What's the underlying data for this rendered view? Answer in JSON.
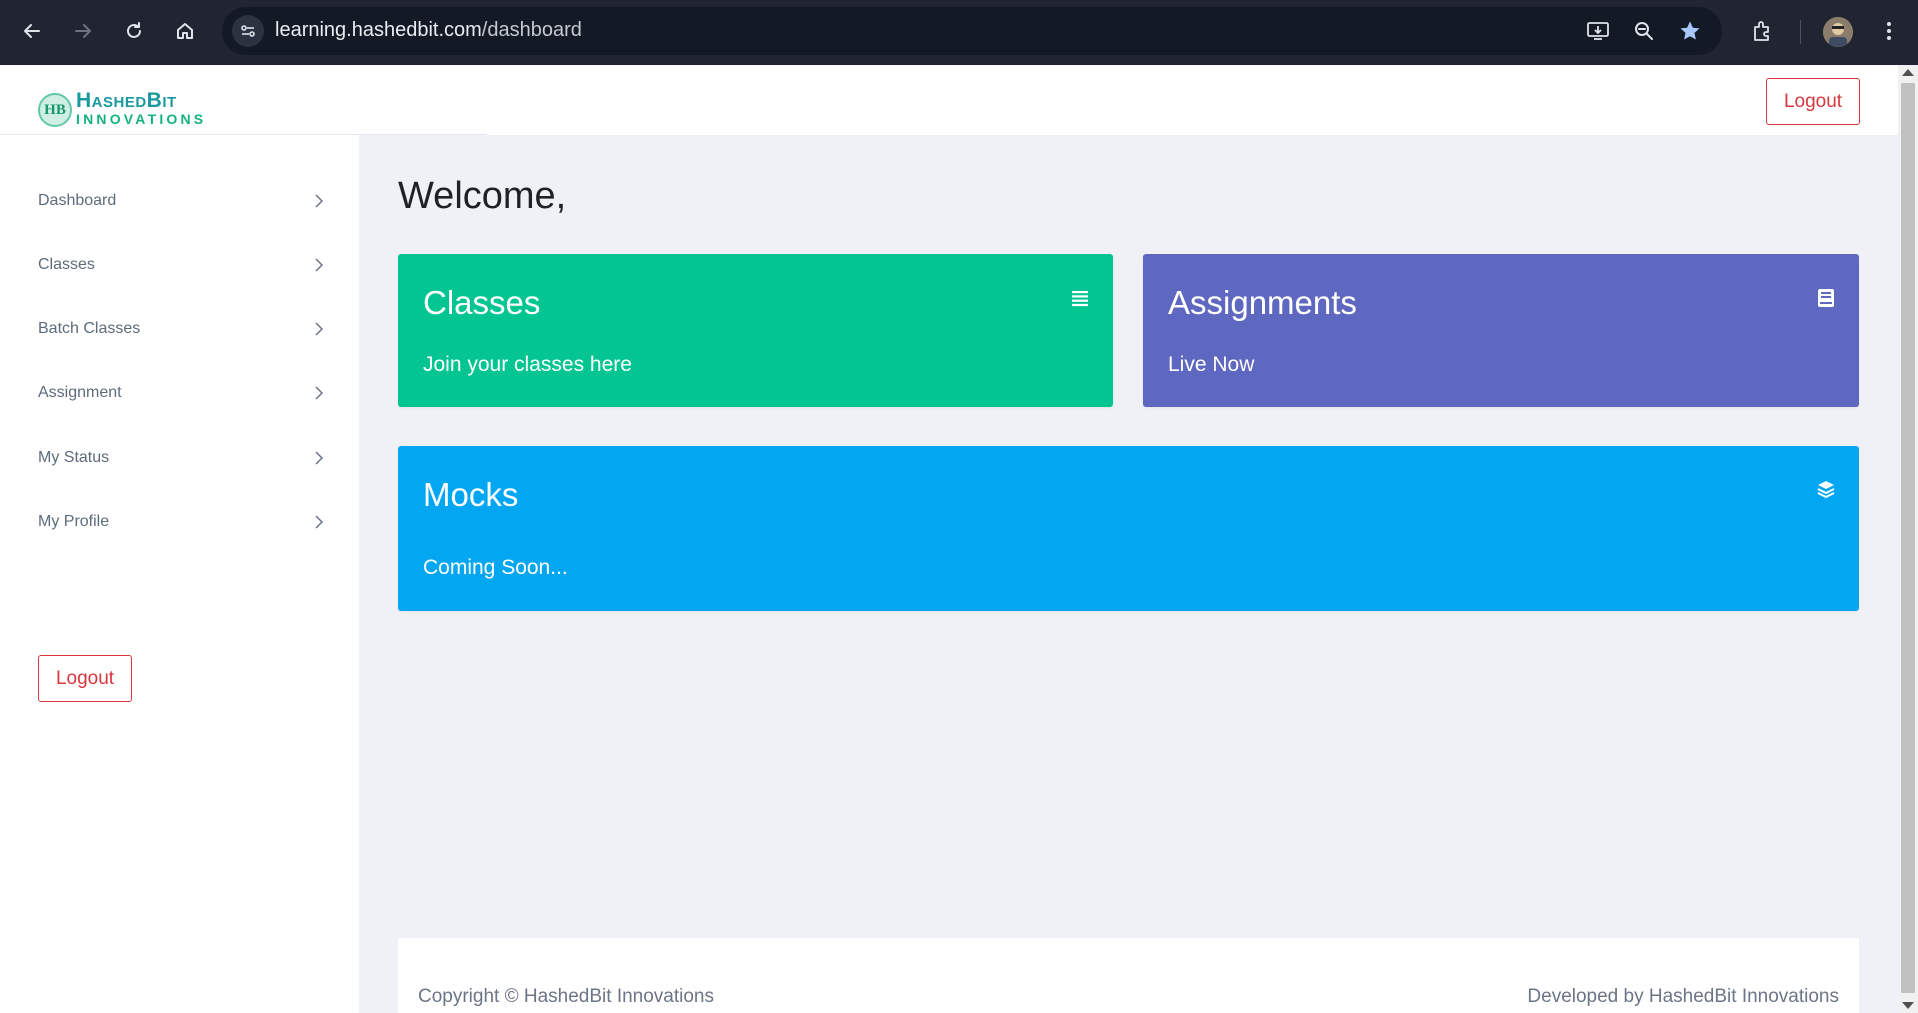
{
  "browser": {
    "url_host": "learning.hashedbit.com",
    "url_path": "/dashboard"
  },
  "logo": {
    "mark": "HB",
    "line1": "HashedBit",
    "line2": "Innovations"
  },
  "header": {
    "logout_label": "Logout"
  },
  "sidebar": {
    "items": [
      {
        "label": "Dashboard"
      },
      {
        "label": "Classes"
      },
      {
        "label": "Batch Classes"
      },
      {
        "label": "Assignment"
      },
      {
        "label": "My Status"
      },
      {
        "label": "My Profile"
      }
    ],
    "logout_label": "Logout"
  },
  "main": {
    "welcome": "Welcome,",
    "cards": [
      {
        "title": "Classes",
        "subtitle": "Join your classes here",
        "icon": "list-icon",
        "color": "#03c591"
      },
      {
        "title": "Assignments",
        "subtitle": "Live Now",
        "icon": "book-icon",
        "color": "#5f68c0"
      },
      {
        "title": "Mocks",
        "subtitle": "Coming Soon...",
        "icon": "layers-icon",
        "color": "#03a7f1"
      }
    ]
  },
  "footer": {
    "copyright": "Copyright © HashedBit Innovations",
    "developed_by": "Developed by HashedBit Innovations"
  }
}
